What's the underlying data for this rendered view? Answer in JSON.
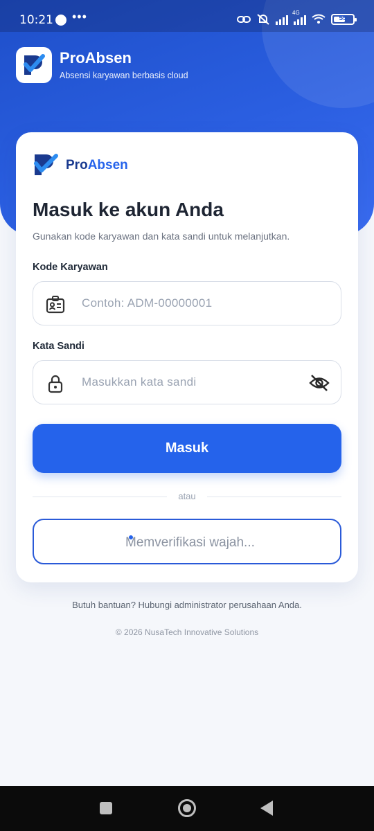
{
  "status_bar": {
    "time": "10:21",
    "dots": "•••",
    "battery_level": "55",
    "network": "4G"
  },
  "header": {
    "app_name": "ProAbsen",
    "tagline": "Absensi karyawan berbasis cloud"
  },
  "card": {
    "brand_prefix": "Pro",
    "brand_suffix": "Absen",
    "title": "Masuk ke akun Anda",
    "subtitle": "Gunakan kode karyawan dan kata sandi untuk melanjutkan.",
    "employee_code": {
      "label": "Kode Karyawan",
      "placeholder": "Contoh: ADM-00000001",
      "value": ""
    },
    "password": {
      "label": "Kata Sandi",
      "placeholder": "Masukkan kata sandi",
      "value": ""
    },
    "login_button": "Masuk",
    "divider_text": "atau",
    "face_button": "Memverifikasi wajah..."
  },
  "footer": {
    "help": "Butuh bantuan? Hubungi administrator perusahaan Anda.",
    "copyright": "© 2026 NusaTech Innovative Solutions"
  },
  "colors": {
    "primary": "#2563eb",
    "hero": "#1e4fc9",
    "brand_dark": "#1a3a8f"
  },
  "icons": {
    "brand": "checkmark-shield-logo-icon",
    "employee_field": "id-card-icon",
    "password_field": "lock-icon",
    "toggle_password": "eye-off-icon"
  }
}
